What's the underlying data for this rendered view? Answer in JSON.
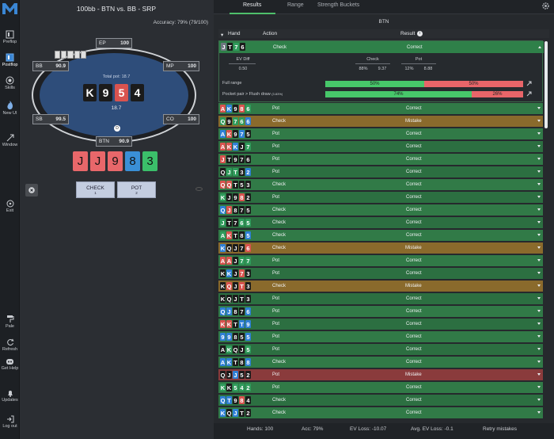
{
  "sidebar": {
    "items": [
      {
        "label": "Preflop",
        "icon": "preflop-icon"
      },
      {
        "label": "Postflop",
        "icon": "postflop-icon"
      },
      {
        "label": "Skills",
        "icon": "skills-icon"
      },
      {
        "label": "New UI",
        "icon": "flame-icon"
      },
      {
        "label": "Window",
        "icon": "window-icon"
      },
      {
        "label": "Exit",
        "icon": "exit-icon"
      },
      {
        "label": "Pale",
        "icon": "paint-roller-icon"
      },
      {
        "label": "Refresh",
        "icon": "refresh-icon"
      },
      {
        "label": "Get Help",
        "icon": "discord-icon"
      },
      {
        "label": "Updates",
        "icon": "bell-icon"
      },
      {
        "label": "Log out",
        "icon": "logout-icon"
      }
    ]
  },
  "game": {
    "title": "100bb - BTN vs. BB - SRP",
    "accuracy_label": "Accuracy:",
    "accuracy_value": "79% (79/100)",
    "total_pot": "Total pot: 18.7",
    "pot": "18.7",
    "board": [
      {
        "rank": "K",
        "suit_color": "#1b1b1b"
      },
      {
        "rank": "9",
        "suit_color": "#1b1b1b"
      },
      {
        "rank": "5",
        "suit_color": "#d9534f"
      },
      {
        "rank": "4",
        "suit_color": "#1b1b1b"
      }
    ],
    "hole_cards": [
      {
        "rank": "J",
        "suit_color": "#e8676a"
      },
      {
        "rank": "J",
        "suit_color": "#e8676a"
      },
      {
        "rank": "9",
        "suit_color": "#e8676a"
      },
      {
        "rank": "8",
        "suit_color": "#3a8fd6"
      },
      {
        "rank": "3",
        "suit_color": "#3bbf6a"
      }
    ],
    "seats": {
      "ep": {
        "name": "EP",
        "stack": "100"
      },
      "mp": {
        "name": "MP",
        "stack": "100"
      },
      "co": {
        "name": "CO",
        "stack": "100"
      },
      "btn": {
        "name": "BTN",
        "stack": "90.9"
      },
      "sb": {
        "name": "SB",
        "stack": "99.5"
      },
      "bb": {
        "name": "BB",
        "stack": "90.9"
      }
    },
    "actions": [
      {
        "label": "CHECK",
        "hotkey": "1"
      },
      {
        "label": "POT",
        "hotkey": "2"
      }
    ]
  },
  "results": {
    "tabs": [
      "Results",
      "Range",
      "Strength Buckets"
    ],
    "active_tab": "Results",
    "position": "BTN",
    "headers": {
      "hand": "Hand",
      "action": "Action",
      "result": "Result"
    },
    "expanded": {
      "hand": [
        "J",
        "T",
        "7",
        "6"
      ],
      "colors": [
        "#6e7680",
        "#1b1b1b",
        "#2f9b5b",
        "#1b1b1b"
      ],
      "action": "Check",
      "result": "Correct",
      "ev_diff_label": "EV Diff",
      "ev_diff": "0.50",
      "check_label": "Check",
      "check_freq": "88%",
      "check_ev": "9.37",
      "pot_label": "Pot",
      "pot_freq": "12%",
      "pot_ev": "8.88",
      "full_range_label": "Full range",
      "full_range_check": 50,
      "full_range_pot": 50,
      "full_range_check_text": "50%",
      "full_range_pot_text": "50%",
      "bucket_label": "Pocket pair > Flush draw",
      "bucket_sub": "(3.83%)",
      "bucket_check": 74,
      "bucket_pot": 26,
      "bucket_check_text": "74%",
      "bucket_pot_text": "26%"
    },
    "rows": [
      {
        "hand": [
          "A",
          "K",
          "9",
          "8",
          "6"
        ],
        "colors": [
          "#d9534f",
          "#2f7fd6",
          "#1b1b1b",
          "#d9534f",
          "#2f9b5b"
        ],
        "action": "Pot",
        "result": "Correct"
      },
      {
        "hand": [
          "Q",
          "9",
          "7",
          "6",
          "6"
        ],
        "colors": [
          "#2f9b5b",
          "#1b1b1b",
          "#2f9b5b",
          "#2f9b5b",
          "#2f7fd6"
        ],
        "action": "Check",
        "result": "Mistake"
      },
      {
        "hand": [
          "A",
          "K",
          "9",
          "7",
          "5"
        ],
        "colors": [
          "#2f7fd6",
          "#d9534f",
          "#1b1b1b",
          "#2f7fd6",
          "#1b1b1b"
        ],
        "action": "Pot",
        "result": "Correct"
      },
      {
        "hand": [
          "A",
          "K",
          "K",
          "J",
          "7"
        ],
        "colors": [
          "#d9534f",
          "#d9534f",
          "#2f7fd6",
          "#1b1b1b",
          "#2f9b5b"
        ],
        "action": "Pot",
        "result": "Correct"
      },
      {
        "hand": [
          "J",
          "T",
          "9",
          "7",
          "6"
        ],
        "colors": [
          "#d9534f",
          "#1b1b1b",
          "#1b1b1b",
          "#1b1b1b",
          "#1b1b1b"
        ],
        "action": "Pot",
        "result": "Correct"
      },
      {
        "hand": [
          "Q",
          "J",
          "T",
          "3",
          "2"
        ],
        "colors": [
          "#1b1b1b",
          "#2f9b5b",
          "#2f9b5b",
          "#1b1b1b",
          "#2f7fd6"
        ],
        "action": "Pot",
        "result": "Correct"
      },
      {
        "hand": [
          "Q",
          "Q",
          "T",
          "5",
          "3"
        ],
        "colors": [
          "#d9534f",
          "#d9534f",
          "#1b1b1b",
          "#1b1b1b",
          "#1b1b1b"
        ],
        "action": "Check",
        "result": "Correct"
      },
      {
        "hand": [
          "K",
          "J",
          "9",
          "8",
          "2"
        ],
        "colors": [
          "#2f9b5b",
          "#1b1b1b",
          "#1b1b1b",
          "#d9534f",
          "#1b1b1b"
        ],
        "action": "Pot",
        "result": "Correct"
      },
      {
        "hand": [
          "Q",
          "J",
          "8",
          "7",
          "5"
        ],
        "colors": [
          "#2f7fd6",
          "#d9534f",
          "#1b1b1b",
          "#1b1b1b",
          "#1b1b1b"
        ],
        "action": "Check",
        "result": "Correct"
      },
      {
        "hand": [
          "J",
          "T",
          "7",
          "6",
          "5"
        ],
        "colors": [
          "#2f9b5b",
          "#1b1b1b",
          "#1b1b1b",
          "#2f9b5b",
          "#2f9b5b"
        ],
        "action": "Check",
        "result": "Correct"
      },
      {
        "hand": [
          "A",
          "K",
          "T",
          "8",
          "5"
        ],
        "colors": [
          "#2f9b5b",
          "#d9534f",
          "#1b1b1b",
          "#1b1b1b",
          "#2f7fd6"
        ],
        "action": "Check",
        "result": "Correct"
      },
      {
        "hand": [
          "K",
          "Q",
          "J",
          "7",
          "6"
        ],
        "colors": [
          "#2f7fd6",
          "#1b1b1b",
          "#1b1b1b",
          "#1b1b1b",
          "#d9534f"
        ],
        "action": "Check",
        "result": "Mistake"
      },
      {
        "hand": [
          "A",
          "A",
          "J",
          "7",
          "7"
        ],
        "colors": [
          "#d9534f",
          "#d9534f",
          "#1b1b1b",
          "#2f9b5b",
          "#2f9b5b"
        ],
        "action": "Pot",
        "result": "Correct"
      },
      {
        "hand": [
          "K",
          "K",
          "J",
          "7",
          "3"
        ],
        "colors": [
          "#1b1b1b",
          "#2f7fd6",
          "#1b1b1b",
          "#d9534f",
          "#1b1b1b"
        ],
        "action": "Pot",
        "result": "Correct"
      },
      {
        "hand": [
          "K",
          "Q",
          "J",
          "T",
          "3"
        ],
        "colors": [
          "#1b1b1b",
          "#d9534f",
          "#1b1b1b",
          "#d9534f",
          "#1b1b1b"
        ],
        "action": "Check",
        "result": "Mistake"
      },
      {
        "hand": [
          "K",
          "Q",
          "J",
          "T",
          "3"
        ],
        "colors": [
          "#1b1b1b",
          "#1b1b1b",
          "#1b1b1b",
          "#1b1b1b",
          "#1b1b1b"
        ],
        "action": "Pot",
        "result": "Correct"
      },
      {
        "hand": [
          "Q",
          "J",
          "8",
          "7",
          "6"
        ],
        "colors": [
          "#2f7fd6",
          "#2f7fd6",
          "#1b1b1b",
          "#1b1b1b",
          "#2f7fd6"
        ],
        "action": "Pot",
        "result": "Correct"
      },
      {
        "hand": [
          "K",
          "K",
          "T",
          "T",
          "9"
        ],
        "colors": [
          "#d9534f",
          "#d9534f",
          "#1b1b1b",
          "#2f7fd6",
          "#2f7fd6"
        ],
        "action": "Pot",
        "result": "Correct"
      },
      {
        "hand": [
          "9",
          "9",
          "8",
          "5",
          "5"
        ],
        "colors": [
          "#2f7fd6",
          "#2f7fd6",
          "#1b1b1b",
          "#1b1b1b",
          "#2f7fd6"
        ],
        "action": "Pot",
        "result": "Correct"
      },
      {
        "hand": [
          "A",
          "K",
          "Q",
          "J",
          "5"
        ],
        "colors": [
          "#1b1b1b",
          "#2f9b5b",
          "#1b1b1b",
          "#1b1b1b",
          "#2f9b5b"
        ],
        "action": "Pot",
        "result": "Correct"
      },
      {
        "hand": [
          "A",
          "K",
          "T",
          "8",
          "8"
        ],
        "colors": [
          "#2f7fd6",
          "#2f7fd6",
          "#1b1b1b",
          "#1b1b1b",
          "#2f7fd6"
        ],
        "action": "Check",
        "result": "Correct"
      },
      {
        "hand": [
          "Q",
          "J",
          "J",
          "5",
          "2"
        ],
        "colors": [
          "#1b1b1b",
          "#1b1b1b",
          "#2f7fd6",
          "#1b1b1b",
          "#1b1b1b"
        ],
        "action": "Pot",
        "result": "Mistake"
      },
      {
        "hand": [
          "K",
          "K",
          "5",
          "4",
          "2"
        ],
        "colors": [
          "#2f9b5b",
          "#1b1b1b",
          "#2f9b5b",
          "#2f9b5b",
          "#2f9b5b"
        ],
        "action": "Pot",
        "result": "Correct"
      },
      {
        "hand": [
          "Q",
          "T",
          "9",
          "8",
          "4"
        ],
        "colors": [
          "#2f7fd6",
          "#2f7fd6",
          "#1b1b1b",
          "#d9534f",
          "#1b1b1b"
        ],
        "action": "Check",
        "result": "Correct"
      },
      {
        "hand": [
          "K",
          "Q",
          "J",
          "T",
          "2"
        ],
        "colors": [
          "#2f7fd6",
          "#1b1b1b",
          "#2f7fd6",
          "#1b1b1b",
          "#1b1b1b"
        ],
        "action": "Check",
        "result": "Correct"
      }
    ],
    "footer": {
      "hands": "Hands: 100",
      "acc": "Acc: 79%",
      "ev_loss": "EV Loss: -10.07",
      "avg_ev_loss": "Avg. EV Loss: -0.1",
      "retry": "Retry mistakes"
    }
  },
  "colors": {
    "correct_row": "#317a47",
    "correct_row_alt": "#2c6f41",
    "mistake_check_row": "#8a6a2c",
    "mistake_pot_row": "#8a3b3c",
    "check_bar": "#47c76a",
    "pot_bar": "#e86569"
  }
}
